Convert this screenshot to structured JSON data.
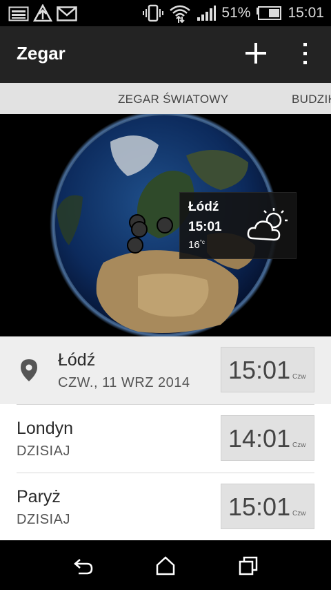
{
  "statusbar": {
    "battery_percent": "51%",
    "clock": "15:01",
    "icons": [
      "image-icon",
      "airplane-upload-icon",
      "gmail-icon",
      "vibrate-icon",
      "wifi-icon",
      "signal-icon",
      "battery-icon"
    ]
  },
  "appbar": {
    "title": "Zegar",
    "add_icon": "plus-icon",
    "menu_icon": "overflow-menu-icon"
  },
  "tabs": {
    "active": "ZEGAR ŚWIATOWY",
    "next": "BUDZIK"
  },
  "popup": {
    "city": "Łódź",
    "time": "15:01",
    "temp": "16",
    "temp_unit": "°c",
    "weather_icon": "partly-cloudy-icon"
  },
  "cities": [
    {
      "name": "Łódź",
      "date": "CZW., 11 WRZ 2014",
      "time": "15:01",
      "day": "Czw",
      "selected": true
    },
    {
      "name": "Londyn",
      "date": "DZISIAJ",
      "time": "14:01",
      "day": "Czw",
      "selected": false
    },
    {
      "name": "Paryż",
      "date": "DZISIAJ",
      "time": "15:01",
      "day": "Czw",
      "selected": false
    }
  ],
  "colors": {
    "appbar": "#232323",
    "tabbar": "#e2e2e2",
    "selected_row": "#eeeeee",
    "timebox": "#e1e1e1"
  },
  "navbar": {
    "icons": [
      "back-icon",
      "home-icon",
      "recent-apps-icon"
    ]
  }
}
